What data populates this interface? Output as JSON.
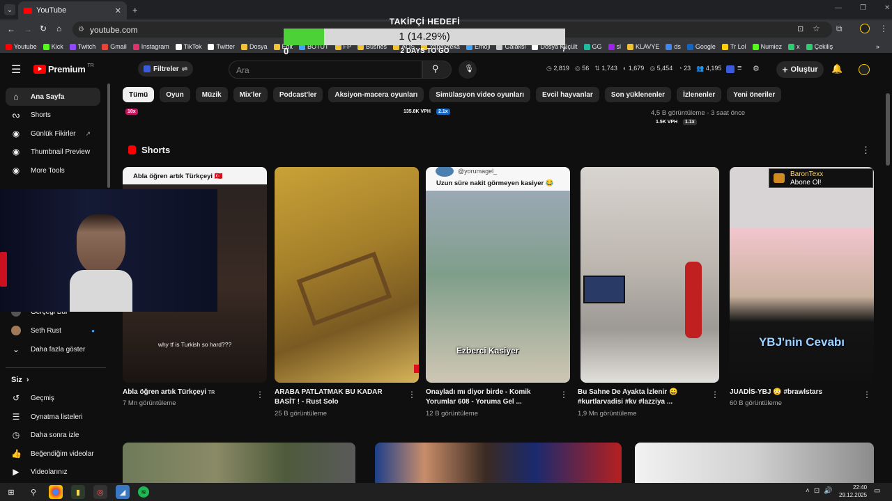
{
  "browser": {
    "tab_title": "YouTube",
    "url": "youtube.com",
    "bookmarks": [
      "Youtube",
      "Kick",
      "Twitch",
      "Gmail",
      "Instagram",
      "TikTok",
      "Twitter",
      "Dosya",
      "Edit",
      "BOTUT",
      "FP",
      "Busnes",
      "AÖS",
      "Yapayzeka",
      "Emoji",
      "Galaksi",
      "Dosya Küçült",
      "GG",
      "sl",
      "KLAVYE",
      "ds",
      "Google",
      "Tr Lol",
      "Numiez",
      "x",
      "Çekiliş"
    ]
  },
  "overlay": {
    "title": "TAKİPÇİ HEDEFİ",
    "progress_text": "1 (14.29%)",
    "progress_fraction": 0.1429,
    "days_text": "2 DAYS TO GO",
    "start_value": "0",
    "end_value": "7"
  },
  "header": {
    "brand": "Premium",
    "brand_region": "TR",
    "filters_label": "Filtreler",
    "search_placeholder": "Ara",
    "stats": [
      "2,819",
      "56",
      "1,743",
      "1,679",
      "5,454",
      "23",
      "4,195"
    ],
    "create_label": "Oluştur"
  },
  "chips": [
    "Tümü",
    "Oyun",
    "Müzik",
    "Mix'ler",
    "Podcast'ler",
    "Aksiyon-macera oyunları",
    "Simülasyon video oyunları",
    "Evcil hayvanlar",
    "Son yüklenenler",
    "İzlenenler",
    "Yeni öneriler"
  ],
  "above_row": {
    "badge_left": "10x",
    "vph_mid": "135.8K VPH",
    "mult_mid": "2.1x",
    "views_right": "4,5 B görüntüleme - 3 saat önce",
    "vph_right": "1.5K VPH",
    "mult_right": "1.1x"
  },
  "sidebar": {
    "top": [
      "Ana Sayfa",
      "Shorts",
      "Günlük Fikirler",
      "Thumbnail Preview",
      "More Tools"
    ],
    "subs": [
      "Gerçeği Bul",
      "Seth Rust"
    ],
    "more": "Daha fazla göster",
    "you_header": "Siz",
    "you_items": [
      "Geçmiş",
      "Oynatma listeleri",
      "Daha sonra izle",
      "Beğendiğim videolar",
      "Videolarınız"
    ]
  },
  "shorts": {
    "heading": "Shorts",
    "items": [
      {
        "title": "Abla öğren artık Türkçeyi",
        "title_suffix": "TR",
        "views": "7 Mn görüntüleme",
        "overlay_top": "Abla öğren artık Türkçeyi 🇹🇷",
        "caption": "why tf is Turkish so hard???"
      },
      {
        "title": "ARABA PATLATMAK BU KADAR BASİT ! - Rust Solo",
        "views": "25 B görüntüleme"
      },
      {
        "title": "Onayladı mı diyor birde - Komik Yorumlar 608 - Yoruma Gel ...",
        "views": "12 B görüntüleme",
        "handle": "@yorumagel_",
        "overlay_top": "Uzun süre nakit görmeyen kasiyer 😂",
        "caption": "Ezberci Kasiyer"
      },
      {
        "title": "Bu Sahne De Ayakta İzlenir 😄 #kurtlarvadisi #kv #lazziya ...",
        "views": "1,9 Mn görüntüleme"
      },
      {
        "title": "JUADİS-YBJ 😳 #brawlstars",
        "views": "60 B görüntüleme",
        "caption": "YBJ'nin Cevabı",
        "alert_name": "BaronTexx",
        "alert_text": "Abone Ol!"
      }
    ]
  },
  "taskbar": {
    "time": "22:40",
    "date": "29.12.2025"
  },
  "colors": {
    "background": "#0f0f0f",
    "chip": "#272727",
    "youtube_red": "#ff0000",
    "goal_fill": "#4cd137"
  }
}
